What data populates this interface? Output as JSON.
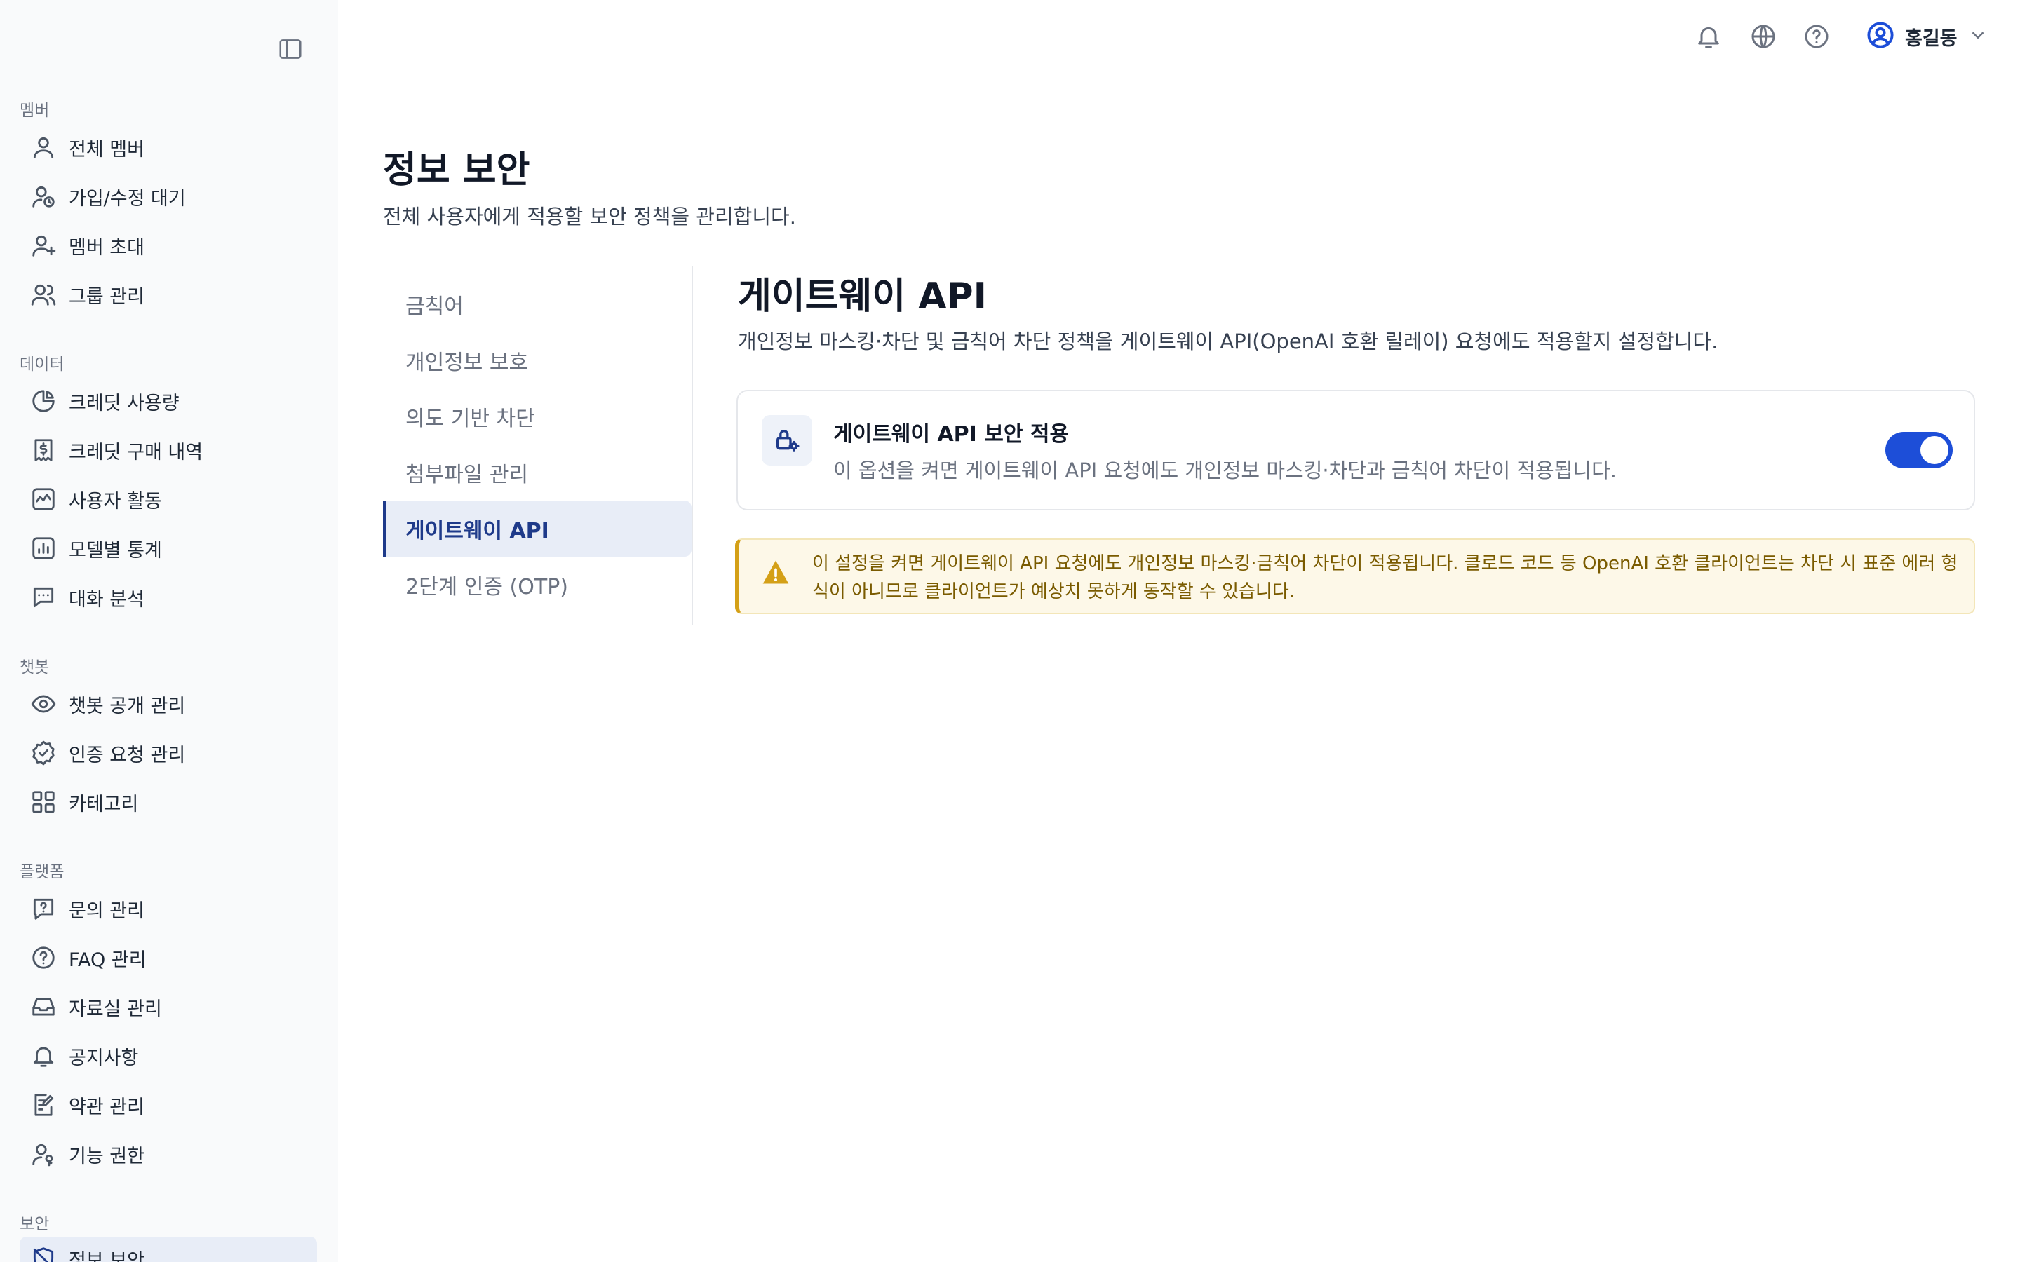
{
  "sidebar": {
    "groups": [
      {
        "label": "멤버",
        "items": [
          {
            "label": "전체 멤버",
            "icon": "user-icon"
          },
          {
            "label": "가입/수정 대기",
            "icon": "user-clock-icon"
          },
          {
            "label": "멤버 초대",
            "icon": "user-plus-icon"
          },
          {
            "label": "그룹 관리",
            "icon": "users-icon"
          }
        ]
      },
      {
        "label": "데이터",
        "items": [
          {
            "label": "크레딧 사용량",
            "icon": "pie-chart-icon"
          },
          {
            "label": "크레딧 구매 내역",
            "icon": "receipt-dollar-icon"
          },
          {
            "label": "사용자 활동",
            "icon": "activity-icon"
          },
          {
            "label": "모델별 통계",
            "icon": "bar-chart-icon"
          },
          {
            "label": "대화 분석",
            "icon": "chat-icon"
          }
        ]
      },
      {
        "label": "챗봇",
        "items": [
          {
            "label": "챗봇 공개 관리",
            "icon": "eye-icon"
          },
          {
            "label": "인증 요청 관리",
            "icon": "badge-check-icon"
          },
          {
            "label": "카테고리",
            "icon": "grid-icon"
          }
        ]
      },
      {
        "label": "플랫폼",
        "items": [
          {
            "label": "문의 관리",
            "icon": "message-question-icon"
          },
          {
            "label": "FAQ 관리",
            "icon": "help-circle-icon"
          },
          {
            "label": "자료실 관리",
            "icon": "inbox-icon"
          },
          {
            "label": "공지사항",
            "icon": "bell-icon"
          },
          {
            "label": "약관 관리",
            "icon": "document-edit-icon"
          },
          {
            "label": "기능 권한",
            "icon": "user-key-icon"
          }
        ]
      },
      {
        "label": "보안",
        "items": [
          {
            "label": "정보 보안",
            "icon": "shield-icon",
            "active": true
          }
        ]
      }
    ]
  },
  "topbar": {
    "user_name": "홍길동"
  },
  "page": {
    "title": "정보 보안",
    "subtitle": "전체 사용자에게 적용할 보안 정책을 관리합니다."
  },
  "subnav": {
    "items": [
      "금칙어",
      "개인정보 보호",
      "의도 기반 차단",
      "첨부파일 관리",
      "게이트웨이 API",
      "2단계 인증 (OTP)"
    ],
    "active_index": 4
  },
  "section": {
    "title": "게이트웨이 API",
    "description": "개인정보 마스킹·차단 및 금칙어 차단 정책을 게이트웨이 API(OpenAI 호환 릴레이) 요청에도 적용할지 설정합니다."
  },
  "setting": {
    "title": "게이트웨이 API 보안 적용",
    "description": "이 옵션을 켜면 게이트웨이 API 요청에도 개인정보 마스킹·차단과 금칙어 차단이 적용됩니다.",
    "enabled": true
  },
  "warning": {
    "text": "이 설정을 켜면 게이트웨이 API 요청에도 개인정보 마스킹·금칙어 차단이 적용됩니다. 클로드 코드 등 OpenAI 호환 클라이언트는 차단 시 표준 에러 형식이 아니므로 클라이언트가 예상치 못하게 동작할 수 있습니다."
  },
  "colors": {
    "accent": "#1d4ed8",
    "active_nav_bg": "#e8edf7",
    "warning_bg": "#fdf8e8",
    "warning_border": "#d4a017"
  }
}
